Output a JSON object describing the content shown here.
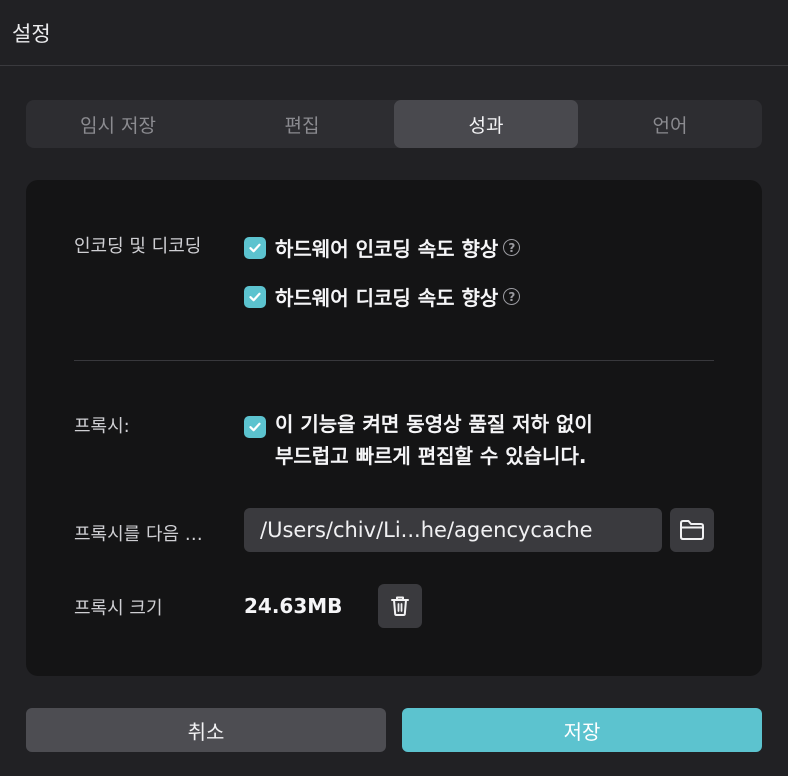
{
  "window": {
    "title": "설정"
  },
  "tabs": [
    {
      "label": "임시 저장",
      "active": false
    },
    {
      "label": "편집",
      "active": false
    },
    {
      "label": "성과",
      "active": true
    },
    {
      "label": "언어",
      "active": false
    }
  ],
  "encoding": {
    "label": "인코딩 및 디코딩",
    "options": [
      {
        "label": "하드웨어 인코딩 속도 향상",
        "checked": true,
        "help_icon": "question-circle-icon"
      },
      {
        "label": "하드웨어 디코딩 속도 향상",
        "checked": true,
        "help_icon": "question-circle-icon"
      }
    ],
    "help_symbol": "?"
  },
  "proxy": {
    "label": "프록시:",
    "checked": true,
    "description_line1": "이 기능을 켜면 동영상 품질 저하 없이",
    "description_line2": "부드럽고 빠르게 편집할 수 있습니다."
  },
  "proxy_location": {
    "label": "프록시를 다음 …",
    "path": "/Users/chiv/Li...he/agencycache",
    "button_icon": "folder-icon"
  },
  "proxy_size": {
    "label": "프록시 크기",
    "value": "24.63MB",
    "button_icon": "trash-icon"
  },
  "footer": {
    "cancel_label": "취소",
    "save_label": "저장"
  },
  "colors": {
    "accent": "#5cc3cf",
    "background": "#212124",
    "panel": "#141415"
  }
}
